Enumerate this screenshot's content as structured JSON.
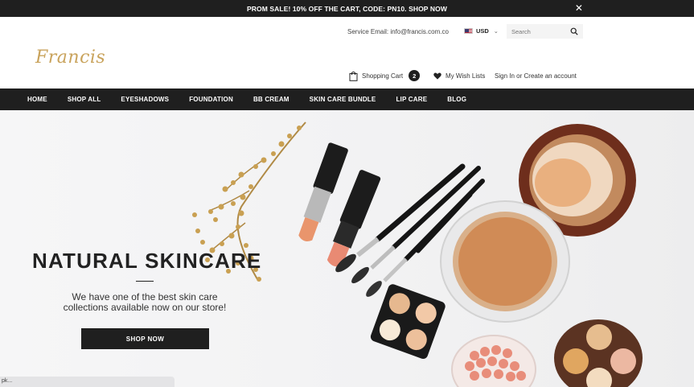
{
  "announcement": {
    "text": "PROM SALE! 10% OFF THE CART, CODE: PN10. SHOP NOW",
    "close_glyph": "✕"
  },
  "header": {
    "service_email": "Service Email: info@francis.com.co",
    "currency": "USD",
    "search_placeholder": "Search",
    "logo_text": "Francis",
    "cart_label": "Shopping Cart",
    "cart_count": "2",
    "wishlist_label": "My Wish Lists",
    "sign_in": "Sign In",
    "or_text": "or",
    "create_account": "Create an account"
  },
  "nav": [
    "HOME",
    "SHOP ALL",
    "EYESHADOWS",
    "FOUNDATION",
    "BB CREAM",
    "SKIN CARE BUNDLE",
    "LIP CARE",
    "BLOG"
  ],
  "hero": {
    "title": "NATURAL SKINCARE",
    "text": "We have one of the best skin care collections available now on our store!",
    "button": "SHOP NOW"
  },
  "status_bar": {
    "text": "pk..."
  },
  "colors": {
    "dark": "#1f1f1f",
    "logo_gold": "#c9a35c",
    "hero_bg": "#f2f2f3"
  }
}
